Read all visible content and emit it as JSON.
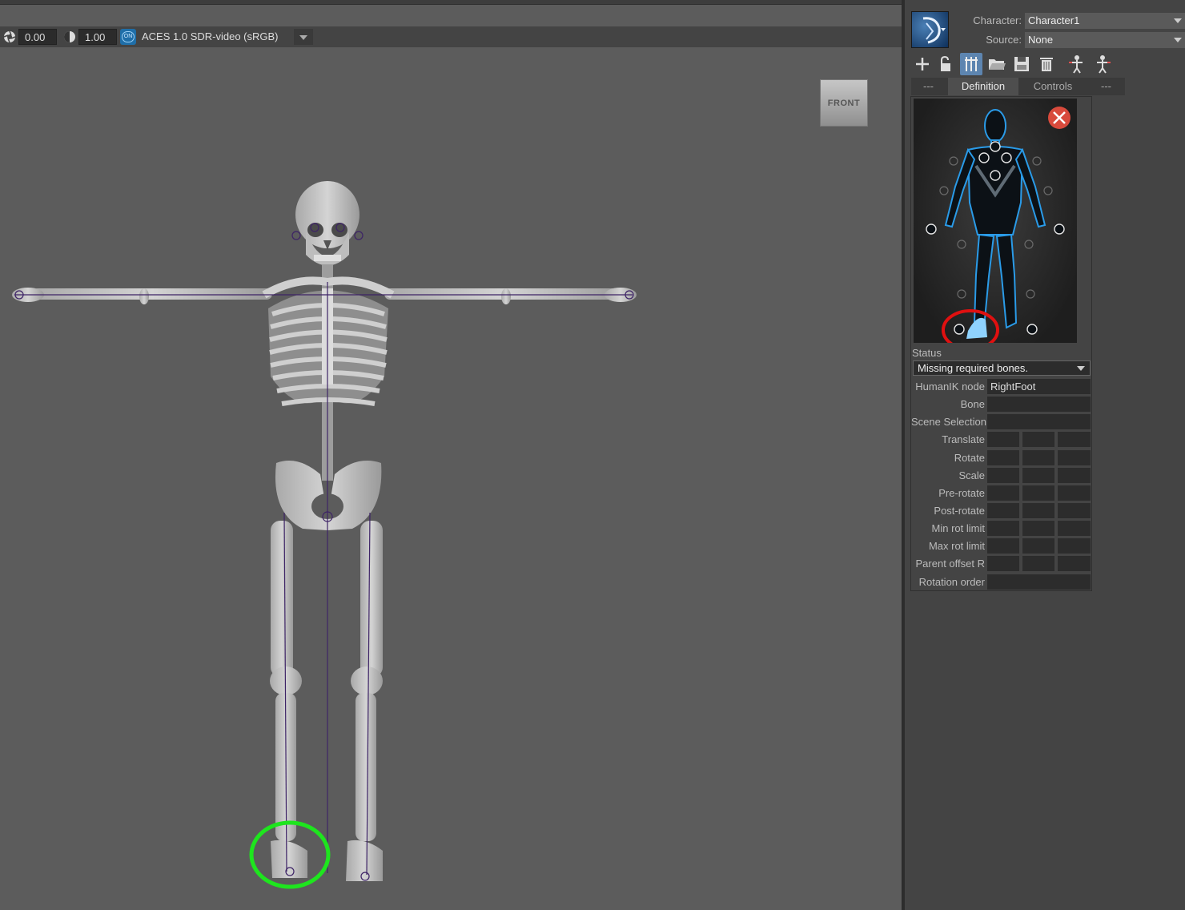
{
  "viewport": {
    "exposure_value": "0.00",
    "gamma_value": "1.00",
    "colormgmt_badge": "ON",
    "colormgmt_label": "ACES 1.0 SDR-video (sRGB)",
    "view_cube_label": "FRONT"
  },
  "panel": {
    "character_label": "Character:",
    "character_value": "Character1",
    "source_label": "Source:",
    "source_value": "None",
    "tabs": [
      "---",
      "Definition",
      "Controls",
      "---"
    ],
    "active_tab": "Definition",
    "status_label": "Status",
    "status_value": "Missing required bones.",
    "properties": [
      {
        "label": "HumanIK node",
        "value": "RightFoot"
      },
      {
        "label": "Bone",
        "value": ""
      },
      {
        "label": "Scene Selection",
        "value": ""
      },
      {
        "label": "Translate"
      },
      {
        "label": "Rotate"
      },
      {
        "label": "Scale"
      },
      {
        "label": "Pre-rotate"
      },
      {
        "label": "Post-rotate"
      },
      {
        "label": "Min rot limit"
      },
      {
        "label": "Max rot limit"
      },
      {
        "label": "Parent offset R"
      },
      {
        "label": "Rotation order",
        "value": ""
      }
    ]
  },
  "annotations": {
    "red_circle_color": "#e01010",
    "green_circle_color": "#1ee51e"
  }
}
